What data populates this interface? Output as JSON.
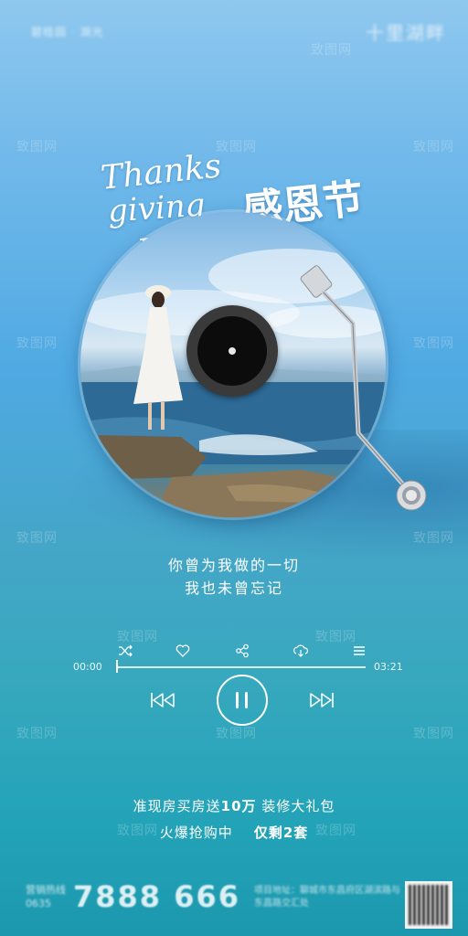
{
  "top_brand": {
    "left_text": "碧桂园 · 湖光",
    "right_text": "十里湖畔"
  },
  "title": {
    "script_line1": "Thanks",
    "script_line2": "giving",
    "script_line3": "Day",
    "chinese": "感恩节"
  },
  "lyrics": [
    "你曾为我做的一切",
    "我也未曾忘记"
  ],
  "player": {
    "time_elapsed": "00:00",
    "time_total": "03:21",
    "progress": 0.0,
    "icons": [
      "shuffle-icon",
      "heart-icon",
      "share-icon",
      "download-icon",
      "menu-icon"
    ],
    "prev_label": "⏮",
    "pause_label": "❚❚",
    "next_label": "⏭"
  },
  "promo": {
    "line1_a": "准现房买房送",
    "line1_b": "10万",
    "line1_c": " 装修大礼包",
    "line2_a": "火爆抢购中",
    "line2_b": "仅剩2套"
  },
  "contact": {
    "hotline_label": "营销热线",
    "area_code": "0635",
    "phone": "7888 666",
    "address": "项目地址：聊城市东昌府区湖滨路与东昌路交汇处"
  },
  "watermark": "致图网",
  "colors": {
    "accent": "#ffffff",
    "sea": "#2e6e9a",
    "bg_top": "#8fc8ee",
    "bg_bottom": "#1c98ae"
  }
}
